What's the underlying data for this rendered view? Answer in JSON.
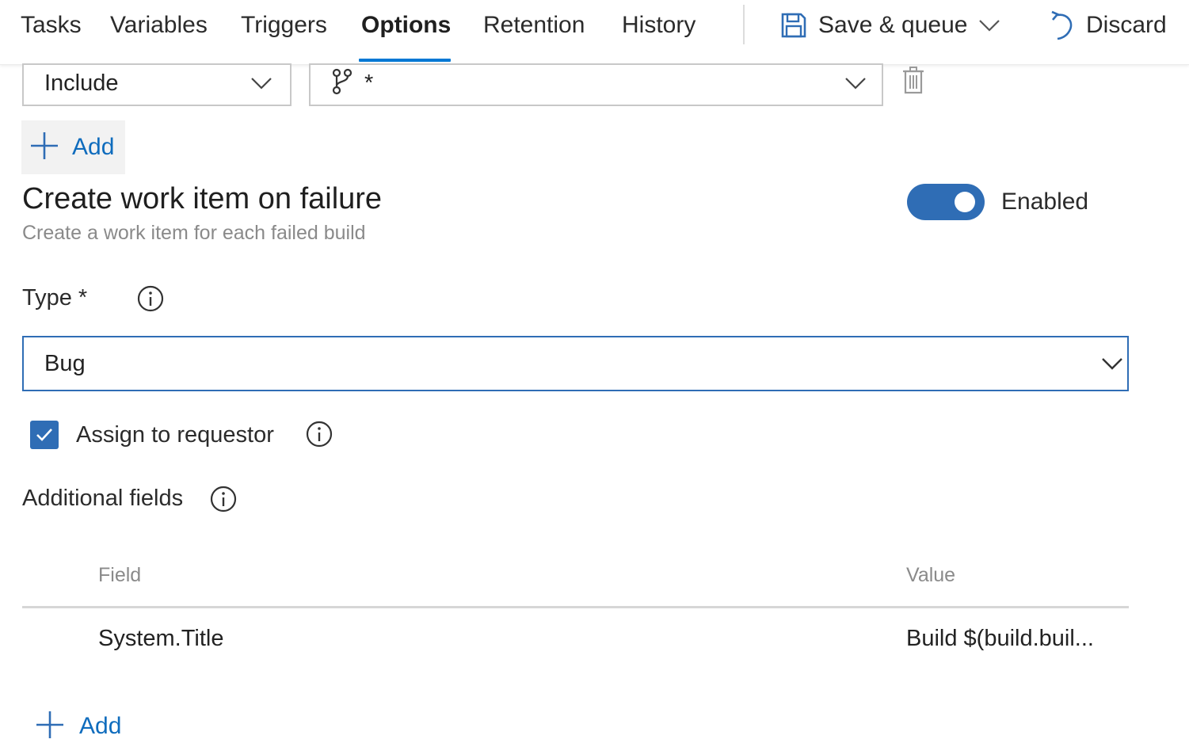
{
  "nav": {
    "tabs": [
      {
        "label": "Tasks"
      },
      {
        "label": "Variables"
      },
      {
        "label": "Triggers"
      },
      {
        "label": "Options",
        "active": true
      },
      {
        "label": "Retention"
      },
      {
        "label": "History"
      }
    ],
    "save_queue_label": "Save & queue",
    "discard_label": "Discard"
  },
  "branch_filter": {
    "mode": "Include",
    "branch_spec": "*"
  },
  "add_filter_label": "Add",
  "work_item": {
    "title": "Create work item on failure",
    "subtitle": "Create a work item for each failed build",
    "toggle_label": "Enabled",
    "toggle_on": true,
    "type_label": "Type *",
    "type_value": "Bug",
    "assign_label": "Assign to requestor",
    "assign_checked": true,
    "additional_fields_label": "Additional fields"
  },
  "fields_table": {
    "columns": [
      "Field",
      "Value"
    ],
    "rows": [
      {
        "field": "System.Title",
        "value": "Build $(build.buil..."
      }
    ]
  },
  "add_field_label": "Add",
  "colors": {
    "accent": "#0078d4",
    "toggle_on": "#2f6db5",
    "link": "#0f6cbd"
  }
}
